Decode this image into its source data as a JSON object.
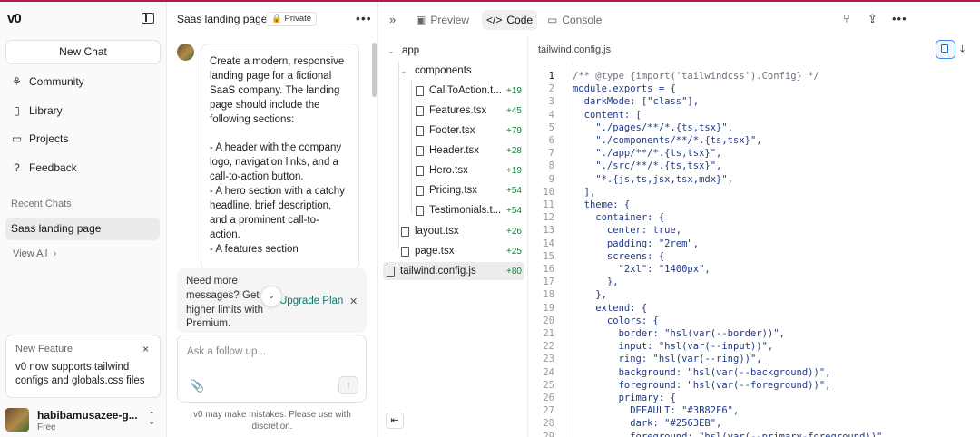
{
  "sidebar": {
    "logo": "v0",
    "new_chat": "New Chat",
    "nav": [
      {
        "label": "Community",
        "icon": "community-icon"
      },
      {
        "label": "Library",
        "icon": "book-icon"
      },
      {
        "label": "Projects",
        "icon": "folder-icon"
      },
      {
        "label": "Feedback",
        "icon": "question-icon"
      }
    ],
    "recent_label": "Recent Chats",
    "recent_chat": "Saas landing page",
    "view_all": "View All",
    "feature": {
      "title": "New Feature",
      "text": "v0 now supports tailwind configs and globals.css files"
    },
    "user": {
      "name": "habibamusazee-g...",
      "plan": "Free"
    }
  },
  "chat": {
    "title": "Saas landing page",
    "badge": "Private",
    "message": "Create a modern, responsive landing page for a fictional SaaS company. The landing page should include the following sections:\n\n- A header with the company logo, navigation links, and a call-to-action button.\n- A hero section with a catchy headline, brief description, and a prominent call-to-action.\n- A features section",
    "upgrade": {
      "text": "Need more messages? Get higher limits with Premium.",
      "link": "Upgrade Plan"
    },
    "followup_placeholder": "Ask a follow up...",
    "disclaimer": "v0 may make mistakes. Please use with discretion."
  },
  "toolbar": {
    "tabs": [
      "Preview",
      "Code",
      "Console"
    ],
    "active_tab": "Code"
  },
  "files": {
    "folder_app": "app",
    "folder_components": "components",
    "components": [
      {
        "name": "CallToAction.t...",
        "count": "+19"
      },
      {
        "name": "Features.tsx",
        "count": "+45"
      },
      {
        "name": "Footer.tsx",
        "count": "+79"
      },
      {
        "name": "Header.tsx",
        "count": "+28"
      },
      {
        "name": "Hero.tsx",
        "count": "+19"
      },
      {
        "name": "Pricing.tsx",
        "count": "+54"
      },
      {
        "name": "Testimonials.t...",
        "count": "+54"
      }
    ],
    "app_files": [
      {
        "name": "layout.tsx",
        "count": "+26"
      },
      {
        "name": "page.tsx",
        "count": "+25"
      }
    ],
    "root_file": {
      "name": "tailwind.config.js",
      "count": "+80"
    }
  },
  "editor": {
    "filename": "tailwind.config.js",
    "lines": [
      "/** @type {import('tailwindcss').Config} */",
      "module.exports = {",
      "  darkMode: [\"class\"],",
      "  content: [",
      "    \"./pages/**/*.{ts,tsx}\",",
      "    \"./components/**/*.{ts,tsx}\",",
      "    \"./app/**/*.{ts,tsx}\",",
      "    \"./src/**/*.{ts,tsx}\",",
      "    \"*.{js,ts,jsx,tsx,mdx}\",",
      "  ],",
      "  theme: {",
      "    container: {",
      "      center: true,",
      "      padding: \"2rem\",",
      "      screens: {",
      "        \"2xl\": \"1400px\",",
      "      },",
      "    },",
      "    extend: {",
      "      colors: {",
      "        border: \"hsl(var(--border))\",",
      "        input: \"hsl(var(--input))\",",
      "        ring: \"hsl(var(--ring))\",",
      "        background: \"hsl(var(--background))\",",
      "        foreground: \"hsl(var(--foreground))\",",
      "        primary: {",
      "          DEFAULT: \"#3B82F6\",",
      "          dark: \"#2563EB\",",
      "          foreground: \"hsl(var(--primary-foreground))\","
    ]
  },
  "colors": {
    "accent_line": "#b5174f",
    "count_green": "#15803d",
    "link_teal": "#0f766e",
    "code_blue": "#1e3a8a"
  }
}
